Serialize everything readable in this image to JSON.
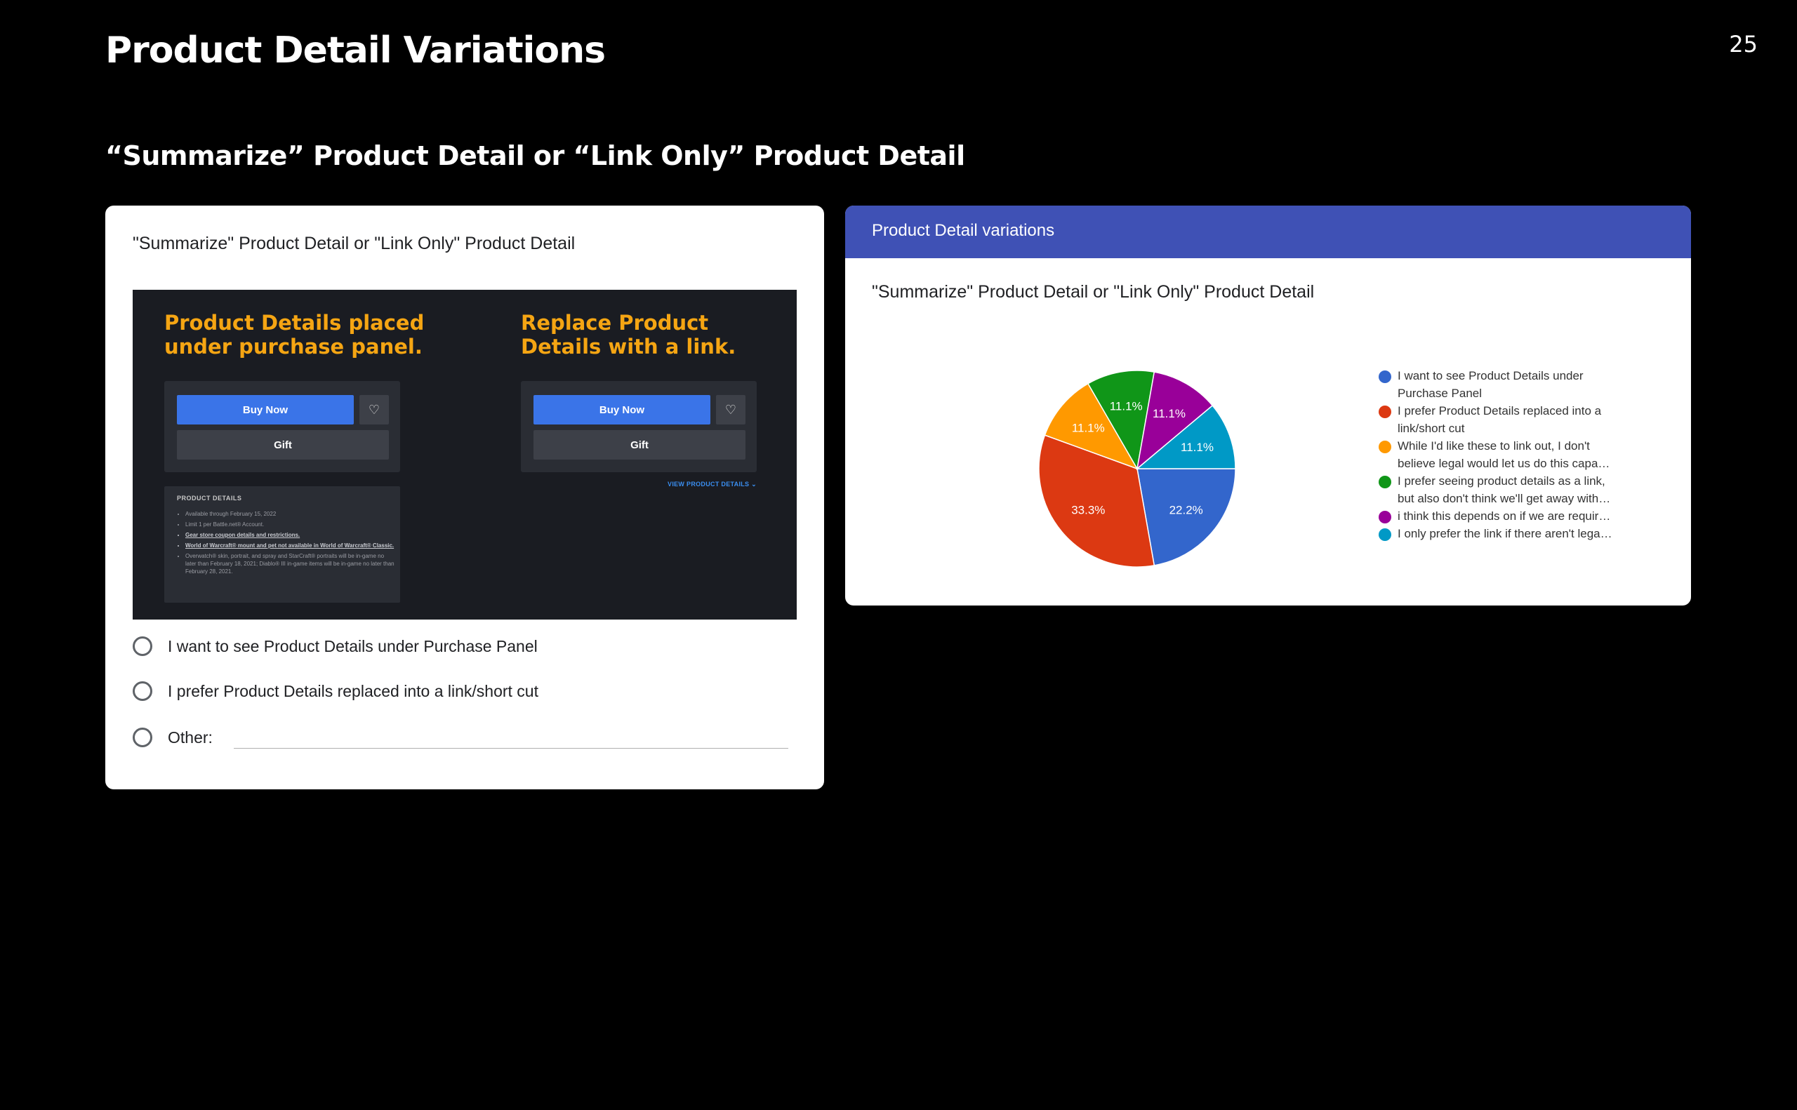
{
  "slide": {
    "title": "Product Detail Variations",
    "page_number": "25",
    "subtitle": "“Summarize” Product Detail or “Link Only” Product Detail"
  },
  "form": {
    "question": "\"Summarize\" Product Detail or \"Link Only\" Product Detail",
    "mockup": {
      "left_heading": "Product Details placed\nunder purchase panel.",
      "right_heading": "Replace Product\nDetails with a link.",
      "buy_now": "Buy Now",
      "gift": "Gift",
      "wishlist_icon": "heart-icon",
      "details_heading": "PRODUCT DETAILS",
      "details_items": [
        "Available through February 15, 2022",
        "Limit 1 per Battle.net® Account.",
        "Gear store coupon details and restrictions.",
        "World of Warcraft® mount and pet not available in World of Warcraft® Classic.",
        "Overwatch® skin, portrait, and spray and StarCraft® portraits will be in-game no later than February 18, 2021; Diablo® III in-game items will be in-game no later than February 28, 2021."
      ],
      "view_details_link": "VIEW PRODUCT DETAILS ⌄"
    },
    "options": [
      "I want to see Product Details under Purchase Panel",
      "I prefer Product Details replaced into a link/short cut",
      "Other:"
    ]
  },
  "results": {
    "header": "Product Detail variations",
    "question": "\"Summarize\" Product Detail or \"Link Only\" Product Detail",
    "legend": [
      {
        "text": "I want to see Product Details under\nPurchase Panel",
        "color": "#3366cc"
      },
      {
        "text": "I prefer Product Details replaced into a\nlink/short cut",
        "color": "#dc3912"
      },
      {
        "text": "While I'd like these to link out, I don't\nbelieve legal would let us do this capa…",
        "color": "#ff9900"
      },
      {
        "text": "I prefer seeing product details as a link,\nbut also don't think we'll get away with…",
        "color": "#109618"
      },
      {
        "text": "i think this depends on if we are requir…",
        "color": "#990099"
      },
      {
        "text": "I only prefer the link if there aren't lega…",
        "color": "#0099c6"
      }
    ]
  },
  "chart_data": {
    "type": "pie",
    "categories": [
      "I want to see Product Details under Purchase Panel",
      "I prefer Product Details replaced into a link/short cut",
      "While I'd like these to link out, I don't believe legal would let us do this capa…",
      "I prefer seeing product details as a link, but also don't think we'll get away with…",
      "i think this depends on if we are requir…",
      "I only prefer the link if there aren't lega…"
    ],
    "values": [
      22.2,
      33.3,
      11.1,
      11.1,
      11.1,
      11.1
    ],
    "labels": [
      "22.2%",
      "33.3%",
      "11.1%",
      "11.1%",
      "11.1%",
      "11.1%"
    ],
    "colors": [
      "#3366cc",
      "#dc3912",
      "#ff9900",
      "#109618",
      "#990099",
      "#0099c6"
    ],
    "title": "\"Summarize\" Product Detail or \"Link Only\" Product Detail",
    "legend_position": "right"
  }
}
